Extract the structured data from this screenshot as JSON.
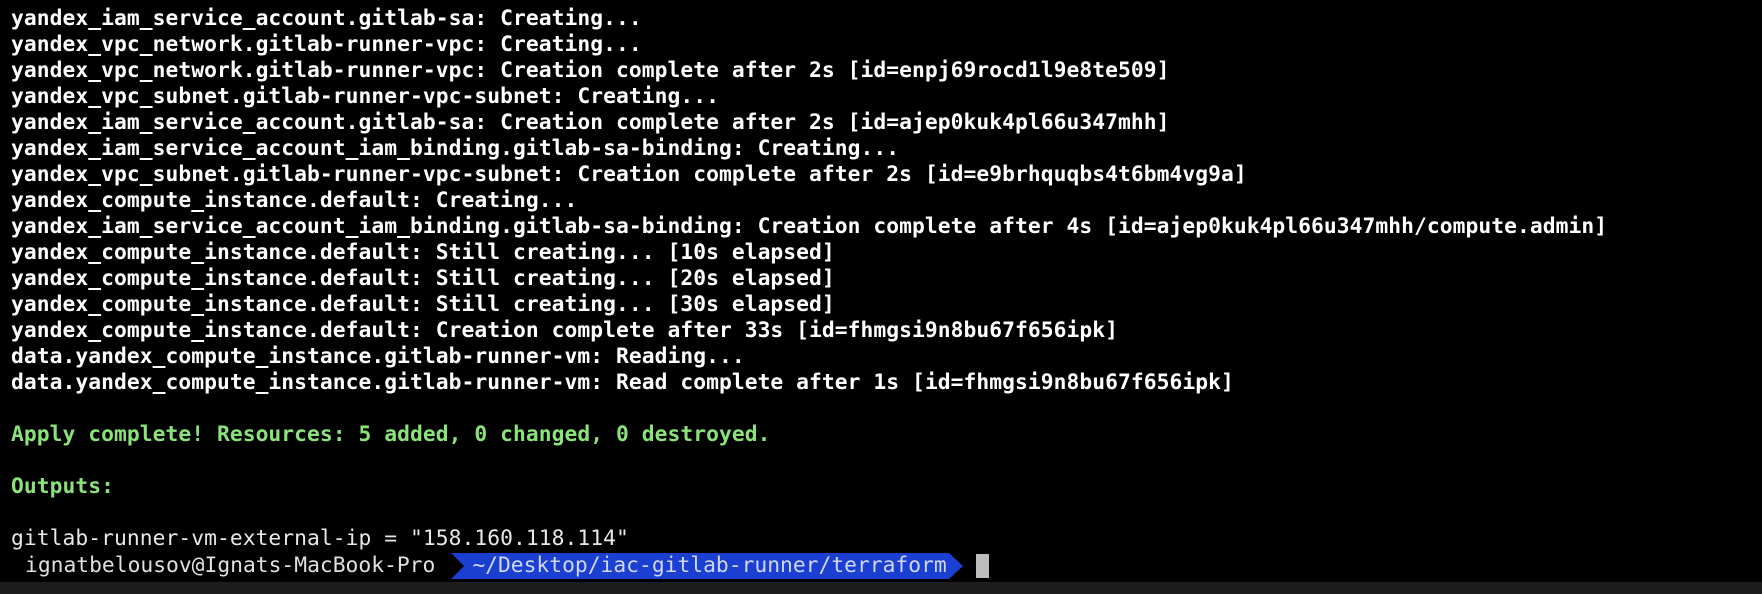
{
  "terminal": {
    "log_lines": [
      "yandex_iam_service_account.gitlab-sa: Creating...",
      "yandex_vpc_network.gitlab-runner-vpc: Creating...",
      "yandex_vpc_network.gitlab-runner-vpc: Creation complete after 2s [id=enpj69rocd1l9e8te509]",
      "yandex_vpc_subnet.gitlab-runner-vpc-subnet: Creating...",
      "yandex_iam_service_account.gitlab-sa: Creation complete after 2s [id=ajep0kuk4pl66u347mhh]",
      "yandex_iam_service_account_iam_binding.gitlab-sa-binding: Creating...",
      "yandex_vpc_subnet.gitlab-runner-vpc-subnet: Creation complete after 2s [id=e9brhquqbs4t6bm4vg9a]",
      "yandex_compute_instance.default: Creating...",
      "yandex_iam_service_account_iam_binding.gitlab-sa-binding: Creation complete after 4s [id=ajep0kuk4pl66u347mhh/compute.admin]",
      "yandex_compute_instance.default: Still creating... [10s elapsed]",
      "yandex_compute_instance.default: Still creating... [20s elapsed]",
      "yandex_compute_instance.default: Still creating... [30s elapsed]",
      "yandex_compute_instance.default: Creation complete after 33s [id=fhmgsi9n8bu67f656ipk]",
      "data.yandex_compute_instance.gitlab-runner-vm: Reading...",
      "data.yandex_compute_instance.gitlab-runner-vm: Read complete after 1s [id=fhmgsi9n8bu67f656ipk]"
    ],
    "apply_summary": "Apply complete! Resources: 5 added, 0 changed, 0 destroyed.",
    "outputs_label": "Outputs:",
    "output_line": "gitlab-runner-vm-external-ip = \"158.160.118.114\"",
    "prompt": {
      "user_host": "ignatbelousov@Ignats-MacBook-Pro",
      "path": "~/Desktop/iac-gitlab-runner/terraform"
    },
    "colors": {
      "background": "#000000",
      "text": "#ffffff",
      "success": "#8be27a",
      "path_segment": "#1a3fd1",
      "cursor": "#bdbdbd"
    }
  }
}
